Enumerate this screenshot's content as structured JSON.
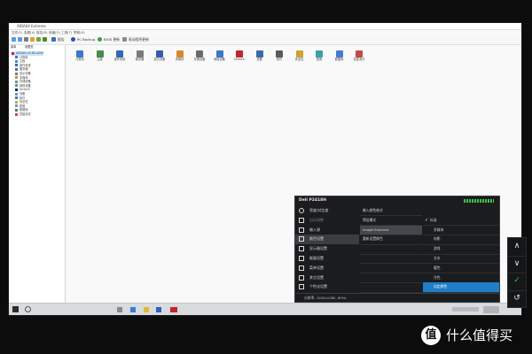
{
  "app": {
    "window_title": "AIDA64 Extreme",
    "menu": [
      "文件(F)",
      "查看(V)",
      "报告(R)",
      "收藏(O)",
      "工具(T)",
      "帮助(H)"
    ],
    "toolbar": {
      "report_label": "报告",
      "pc_backup": "PC Backup",
      "bios_update": "BIOS 更新",
      "driver_update": "驱动程序更新"
    },
    "tree_header": [
      "菜单",
      "收藏夹"
    ],
    "tree_items": [
      "AIDA64 v5.80.4000",
      "计算机",
      "主板",
      "操作系统",
      "服务器",
      "显示设备",
      "多媒体",
      "存储设备",
      "网络设备",
      "DirectX",
      "设备",
      "软件",
      "安全性",
      "配置",
      "数据库",
      "性能测试"
    ],
    "categories": [
      "计算机",
      "主板",
      "操作系统",
      "服务器",
      "显示设备",
      "多媒体",
      "存储设备",
      "网络设备",
      "DirectX",
      "设备",
      "软件",
      "安全性",
      "配置",
      "数据库",
      "性能测试"
    ]
  },
  "osd": {
    "model": "Dell P2418H",
    "menu": [
      {
        "label": "亮度/对比度",
        "icon": "brightness-icon"
      },
      {
        "label": "自动调整",
        "icon": "auto-adjust-icon"
      },
      {
        "label": "输入源",
        "icon": "input-source-icon"
      },
      {
        "label": "颜色设置",
        "icon": "color-icon"
      },
      {
        "label": "显示器设置",
        "icon": "display-icon"
      },
      {
        "label": "能量设置",
        "icon": "energy-icon"
      },
      {
        "label": "菜单设置",
        "icon": "menu-icon"
      },
      {
        "label": "其它设置",
        "icon": "other-icon"
      },
      {
        "label": "个性化设置",
        "icon": "star-icon"
      }
    ],
    "submenu": [
      "输入颜色格式",
      "预设模式",
      "Image Enhance",
      "重新设置颜色"
    ],
    "options": [
      "标准",
      "多媒体",
      "电影",
      "游戏",
      "文本",
      "暖色",
      "冷色",
      "自定颜色"
    ],
    "footer": "分辨率: 1920x1080, 60Hz",
    "colors": {
      "accent": "#1f7ec6",
      "meter": "#3fc24a"
    }
  },
  "side_buttons": [
    "∧",
    "∨",
    "✓",
    "↺"
  ],
  "watermark": {
    "logo": "值",
    "text": "什么值得买"
  }
}
